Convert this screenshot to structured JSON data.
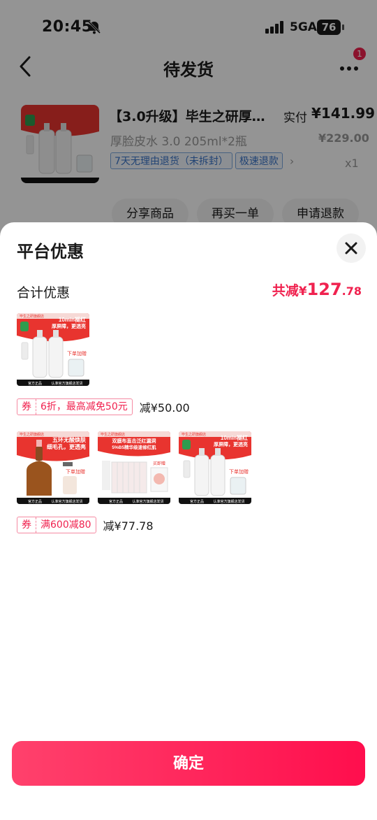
{
  "status_bar": {
    "time": "20:45",
    "network": "5GA",
    "battery": "76"
  },
  "nav": {
    "title": "待发货",
    "badge_count": "1"
  },
  "order": {
    "title": "【3.0升级】毕生之研厚…",
    "variant": "厚脸皮水 3.0 205ml*2瓶",
    "tags": [
      "7天无理由退货（未拆封）",
      "极速退款"
    ],
    "paid_label": "实付",
    "paid_price": "¥141.99",
    "original_price": "¥229.00",
    "quantity": "x1",
    "actions": [
      "分享商品",
      "再买一单",
      "申请退款"
    ]
  },
  "sheet": {
    "title": "平台优惠",
    "total_label": "合计优惠",
    "total_prefix": "共减",
    "total_currency": "¥",
    "total_integer": "127",
    "total_decimal": ".78",
    "confirm_label": "确定"
  },
  "promo_images": {
    "brand_line": "毕生之研旗舰店",
    "toner_headline": "10min褪红",
    "toner_sub": "厚屏障，更透亮",
    "gift_text": "下单加赠",
    "footer_left": "官方正品",
    "footer_right": "认准官方旗舰店发货",
    "serum_headline": "五环无酸焕肤",
    "serum_sub": "细毛孔，更透亮",
    "mask_headline": "双膜布直击泛红漏洞",
    "mask_sub": "5%B5精华级速修红肌",
    "mask_gift": "买即赠"
  },
  "coupons": [
    {
      "kind": "券",
      "desc": "6折，最高减免50元",
      "saving": "减¥50.00"
    },
    {
      "kind": "券",
      "desc": "满600减80",
      "saving": "减¥77.78"
    }
  ],
  "colors": {
    "accent": "#f0224f",
    "tag_blue": "#3a74c8"
  }
}
